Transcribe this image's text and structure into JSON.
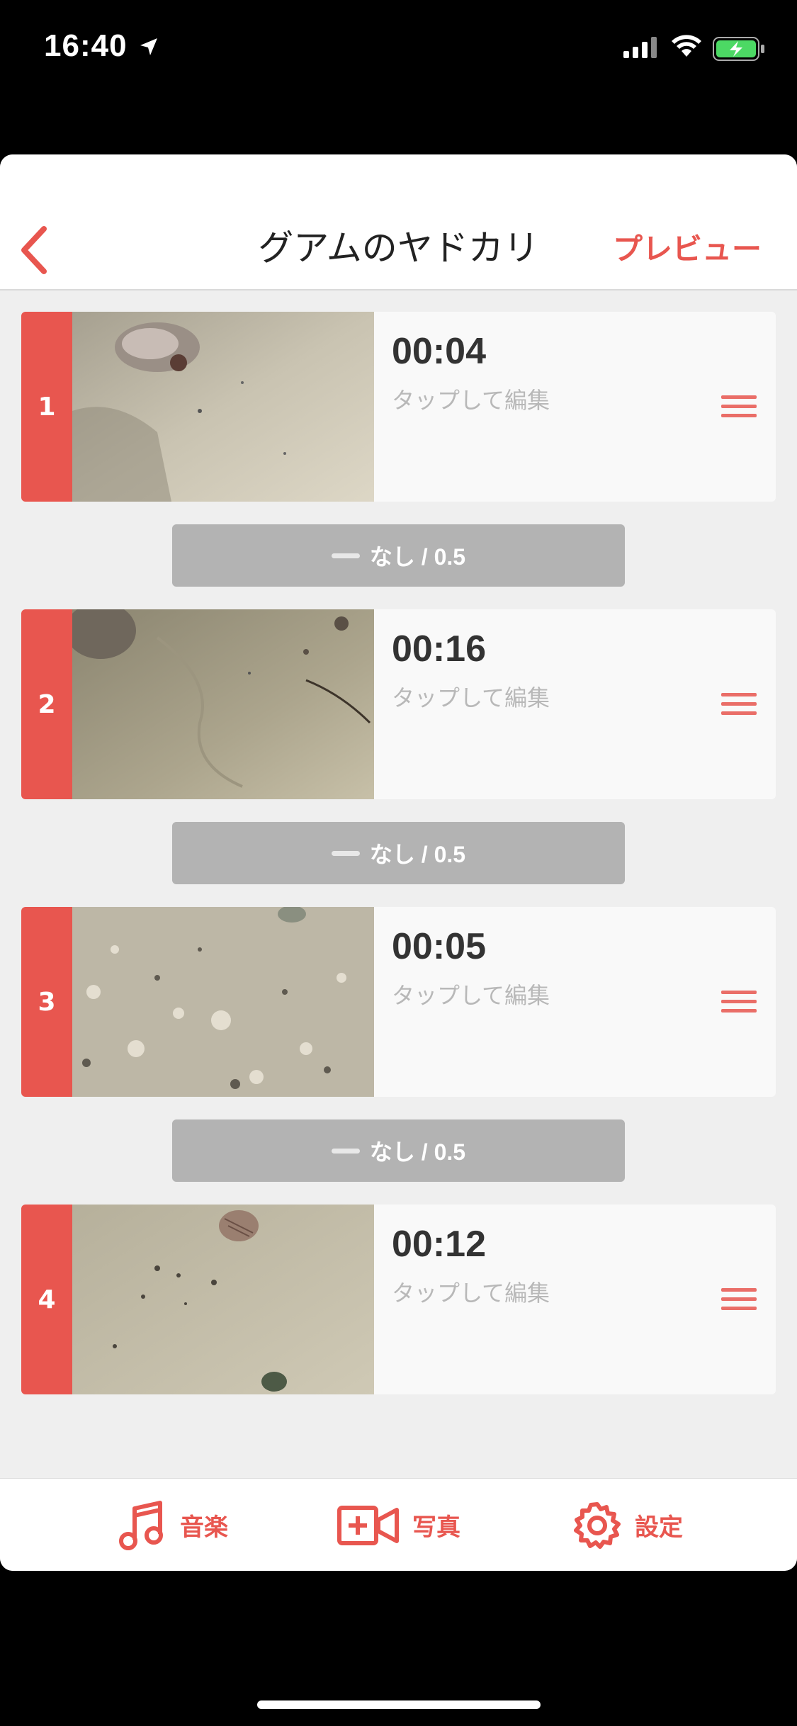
{
  "status_bar": {
    "time": "16:40"
  },
  "nav": {
    "title": "グアムのヤドカリ",
    "preview_label": "プレビュー"
  },
  "clips": [
    {
      "index": "1",
      "duration": "00:04",
      "hint": "タップして編集"
    },
    {
      "index": "2",
      "duration": "00:16",
      "hint": "タップして編集"
    },
    {
      "index": "3",
      "duration": "00:05",
      "hint": "タップして編集"
    },
    {
      "index": "4",
      "duration": "00:12",
      "hint": "タップして編集"
    }
  ],
  "transitions": [
    {
      "label": "なし / 0.5"
    },
    {
      "label": "なし / 0.5"
    },
    {
      "label": "なし / 0.5"
    }
  ],
  "tabs": [
    {
      "label": "音楽",
      "icon": "music-note-icon"
    },
    {
      "label": "写真",
      "icon": "add-video-icon"
    },
    {
      "label": "設定",
      "icon": "gear-icon"
    }
  ],
  "colors": {
    "accent": "#e8564f",
    "transition_bg": "#b3b3b3",
    "background": "#efefef"
  }
}
